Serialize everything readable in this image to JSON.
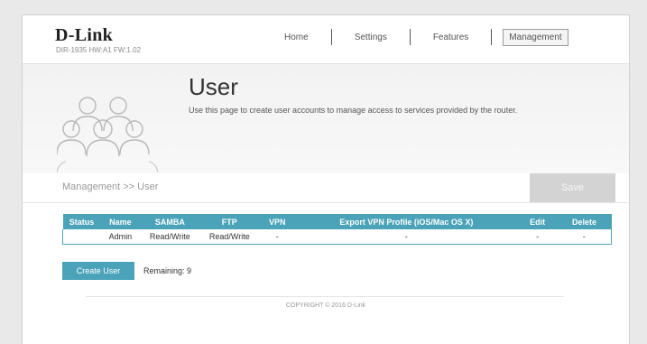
{
  "header": {
    "logo": "D-Link",
    "model": "DIR-1935 HW:A1 FW:1.02",
    "nav": [
      {
        "label": "Home"
      },
      {
        "label": "Settings"
      },
      {
        "label": "Features"
      },
      {
        "label": "Management"
      }
    ]
  },
  "banner": {
    "title": "User",
    "description": "Use this page to create user accounts to manage access to services provided by the router."
  },
  "breadcrumb": "Management >> User",
  "save_label": "Save",
  "table": {
    "headers": [
      "Status",
      "Name",
      "SAMBA",
      "FTP",
      "VPN",
      "Export VPN Profile (iOS/Mac OS X)",
      "Edit",
      "Delete"
    ],
    "rows": [
      [
        "",
        "Admin",
        "Read/Write",
        "Read/Write",
        "-",
        "-",
        "-",
        "-"
      ]
    ]
  },
  "create_user_label": "Create User",
  "remaining": "Remaining: 9",
  "footer": "COPYRIGHT © 2016 D-Link",
  "colors": {
    "accent": "#4aa3b8",
    "save_disabled": "#d3d3d3"
  }
}
